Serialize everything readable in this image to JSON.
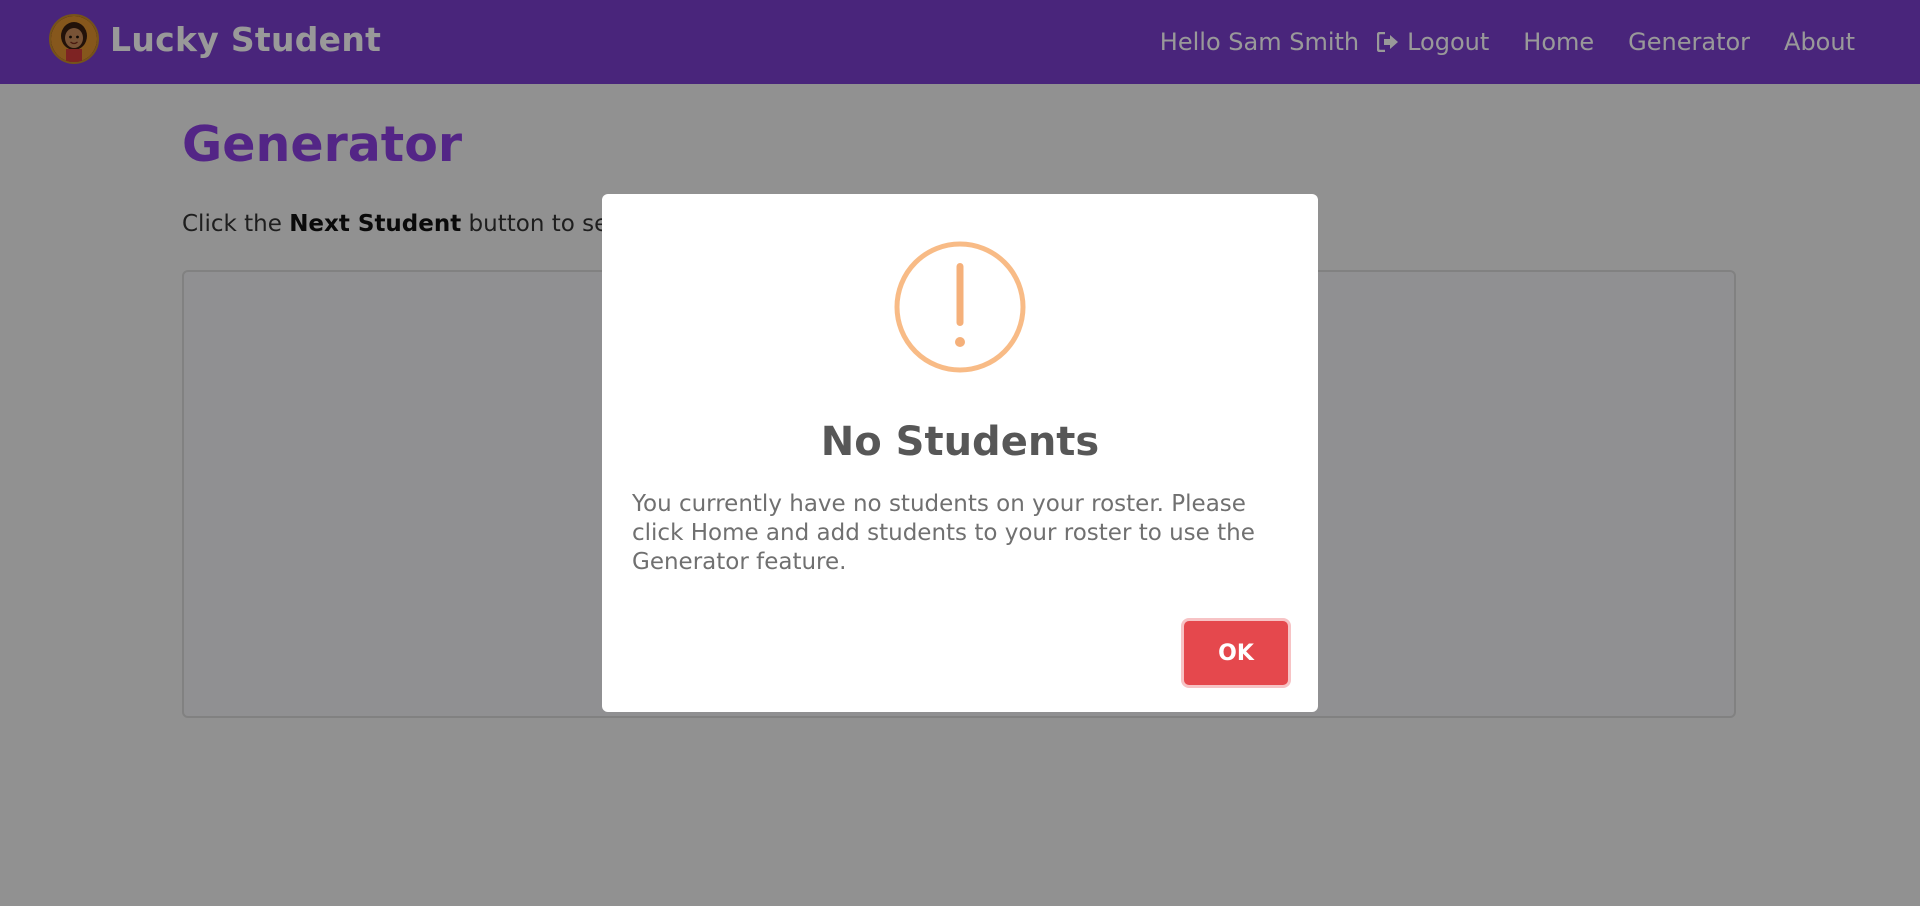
{
  "navbar": {
    "brand": "Lucky Student",
    "greeting": "Hello Sam Smith",
    "logout_label": "Logout",
    "links": [
      "Home",
      "Generator",
      "About"
    ]
  },
  "page": {
    "title": "Generator",
    "instructions_prefix": "Click the ",
    "instructions_bold": "Next Student",
    "instructions_suffix": " button to se"
  },
  "modal": {
    "icon": "warning-icon",
    "title": "No Students",
    "message": "You currently have no students on your roster. Please click Home and add students to your roster to use the Generator feature.",
    "ok_label": "OK"
  },
  "colors": {
    "navbar": "#7b3fce",
    "title": "#8b3ee0",
    "warning": "#f8bb86",
    "ok_button": "#e5484d"
  }
}
